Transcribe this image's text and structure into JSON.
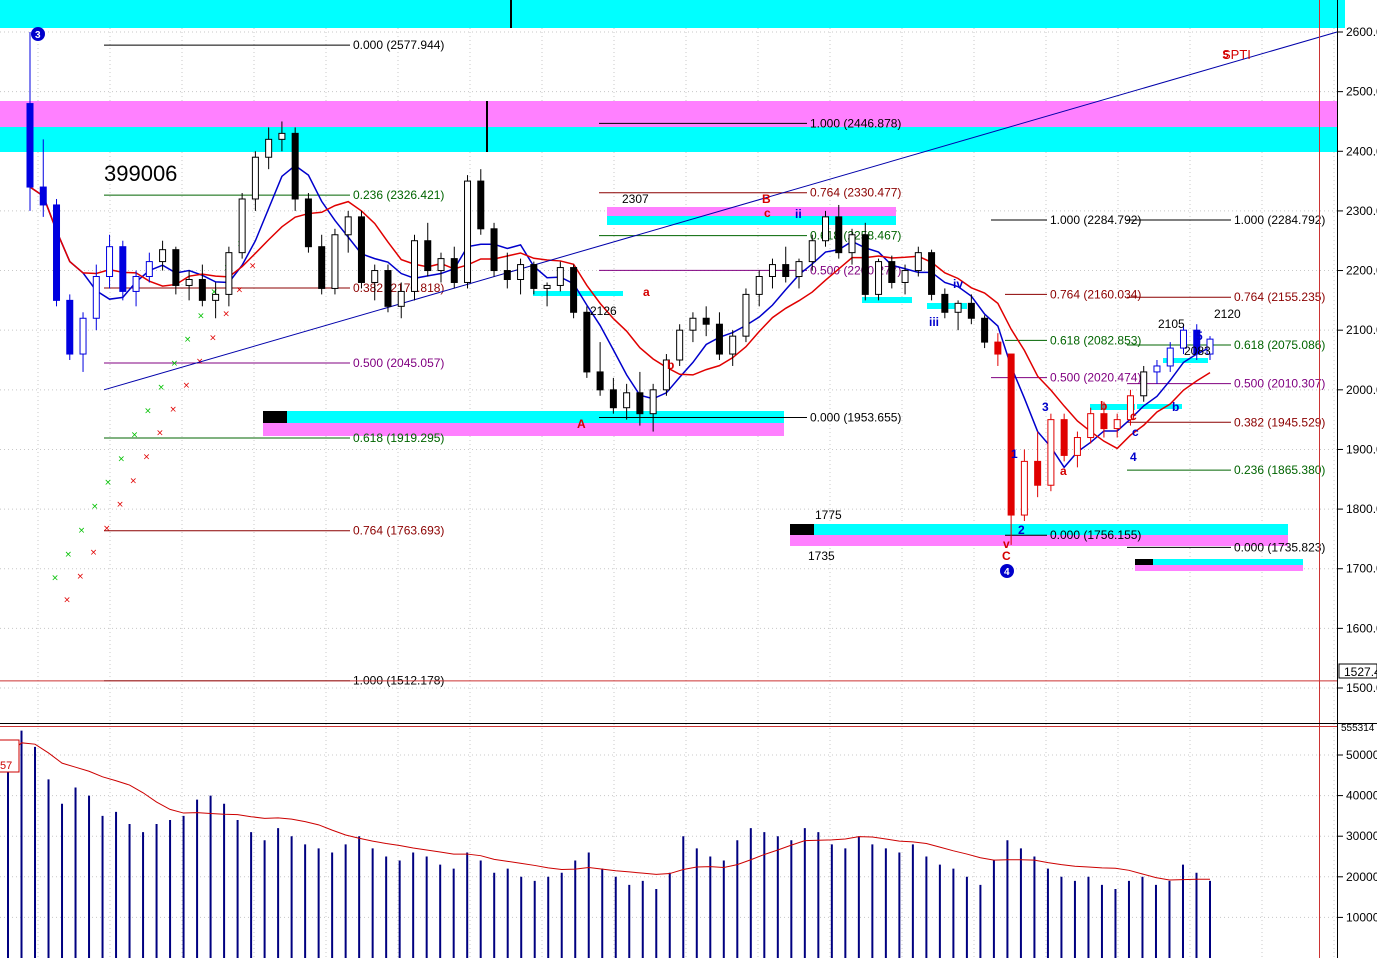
{
  "chart_data": {
    "type": "candlestick",
    "symbol": "399006",
    "indicator_tag": "SPTI",
    "price_axis": {
      "ticks": [
        "2600.0",
        "2500.0",
        "2400.0",
        "2300.0",
        "2200.0",
        "2100.0",
        "2000.0",
        "1900.0",
        "1800.0",
        "1700.0",
        "1600.0",
        "1500.0"
      ],
      "tick_values": [
        2600,
        2500,
        2400,
        2300,
        2200,
        2100,
        2000,
        1900,
        1800,
        1700,
        1600,
        1500
      ],
      "current_marker": "1527.4",
      "ylim": [
        1450,
        2660
      ]
    },
    "volume_axis": {
      "ticks": [
        "50000",
        "40000",
        "30000",
        "20000",
        "10000"
      ],
      "tick_values": [
        50000,
        40000,
        30000,
        20000,
        10000
      ],
      "top_marker": "555314",
      "left_marker": "57",
      "ylim": [
        0,
        56000
      ]
    },
    "fib_levels": [
      {
        "text": "0.000 (2577.944)",
        "value": 2577.944,
        "color": "#000000"
      },
      {
        "text": "0.236 (2326.421)",
        "value": 2326.421,
        "color": "#006400"
      },
      {
        "text": "0.382 (2170.818)",
        "value": 2170.818,
        "color": "#8b0000"
      },
      {
        "text": "0.500 (2045.057)",
        "value": 2045.057,
        "color": "#800080"
      },
      {
        "text": "0.618 (1919.295)",
        "value": 1919.295,
        "color": "#006400"
      },
      {
        "text": "0.764 (1763.693)",
        "value": 1763.693,
        "color": "#8b0000"
      },
      {
        "text": "1.000 (1512.178)",
        "value": 1512.178,
        "color": "#000000"
      },
      {
        "text": "1.000 (2446.878)",
        "value": 2446.878,
        "color": "#000000"
      },
      {
        "text": "0.764 (2330.477)",
        "value": 2330.477,
        "color": "#8b0000"
      },
      {
        "text": "0.618 (2258.467)",
        "value": 2258.467,
        "color": "#006400"
      },
      {
        "text": "0.500 (2200.277)",
        "value": 2200.277,
        "color": "#800080"
      },
      {
        "text": "0.000 (1953.655)",
        "value": 1953.655,
        "color": "#000000"
      },
      {
        "text": "1.000 (2284.792)",
        "value": 2284.792,
        "color": "#000000"
      },
      {
        "text": "0.764 (2160.034)",
        "value": 2160.034,
        "color": "#8b0000"
      },
      {
        "text": "0.618 (2082.853)",
        "value": 2082.853,
        "color": "#006400"
      },
      {
        "text": "0.500 (2020.474)",
        "value": 2020.474,
        "color": "#800080"
      },
      {
        "text": "0.000 (1756.155)",
        "value": 1756.155,
        "color": "#000000"
      },
      {
        "text": "1.000 (2284.792)",
        "value": 2284.792,
        "color": "#000000"
      },
      {
        "text": "0.764 (2155.235)",
        "value": 2155.235,
        "color": "#8b0000"
      },
      {
        "text": "0.618 (2075.086)",
        "value": 2075.086,
        "color": "#006400"
      },
      {
        "text": "0.500 (2010.307)",
        "value": 2010.307,
        "color": "#800080"
      },
      {
        "text": "0.382 (1945.529)",
        "value": 1945.529,
        "color": "#8b0000"
      },
      {
        "text": "0.236 (1865.380)",
        "value": 1865.38,
        "color": "#006400"
      },
      {
        "text": "0.000 (1735.823)",
        "value": 1735.823,
        "color": "#000000"
      }
    ],
    "price_labels": [
      "2307",
      "2126",
      "2105",
      "2120",
      "1775",
      "1735",
      "2083"
    ],
    "wave_labels": {
      "circled": [
        "3",
        "4",
        "5"
      ],
      "red": [
        "B",
        "c",
        "a",
        "b",
        "A",
        "C",
        "a",
        "b",
        "c",
        "v"
      ],
      "blue": [
        "ii",
        "iv",
        "iii",
        "1",
        "2",
        "3",
        "4",
        "5",
        "b",
        "c"
      ]
    },
    "series": [
      {
        "name": "candles",
        "type": "candlestick"
      },
      {
        "name": "ma-blue",
        "type": "line",
        "color": "#0000cc"
      },
      {
        "name": "ma-red",
        "type": "line",
        "color": "#e00000"
      },
      {
        "name": "sar-green",
        "type": "scatter",
        "color": "#00c000"
      },
      {
        "name": "sar-red",
        "type": "scatter",
        "color": "#e00000"
      },
      {
        "name": "volume",
        "type": "bar",
        "color": "#000080"
      },
      {
        "name": "volume-ma",
        "type": "line",
        "color": "#cc0000"
      }
    ],
    "candles": [
      [
        2480,
        2600,
        2300,
        2340
      ],
      [
        2340,
        2420,
        2290,
        2310
      ],
      [
        2310,
        2320,
        2140,
        2150
      ],
      [
        2150,
        2160,
        2050,
        2060
      ],
      [
        2060,
        2130,
        2030,
        2120
      ],
      [
        2120,
        2210,
        2100,
        2190
      ],
      [
        2190,
        2260,
        2170,
        2240
      ],
      [
        2240,
        2250,
        2150,
        2165
      ],
      [
        2165,
        2200,
        2140,
        2190
      ],
      [
        2190,
        2230,
        2180,
        2215
      ],
      [
        2215,
        2250,
        2200,
        2235
      ],
      [
        2235,
        2240,
        2160,
        2175
      ],
      [
        2175,
        2200,
        2150,
        2185
      ],
      [
        2185,
        2210,
        2140,
        2150
      ],
      [
        2150,
        2180,
        2120,
        2160
      ],
      [
        2160,
        2240,
        2140,
        2230
      ],
      [
        2230,
        2330,
        2220,
        2320
      ],
      [
        2320,
        2400,
        2300,
        2390
      ],
      [
        2390,
        2440,
        2370,
        2420
      ],
      [
        2420,
        2450,
        2400,
        2430
      ],
      [
        2430,
        2440,
        2300,
        2320
      ],
      [
        2320,
        2330,
        2230,
        2240
      ],
      [
        2240,
        2260,
        2160,
        2170
      ],
      [
        2170,
        2270,
        2160,
        2260
      ],
      [
        2260,
        2300,
        2230,
        2290
      ],
      [
        2290,
        2300,
        2170,
        2180
      ],
      [
        2180,
        2210,
        2150,
        2200
      ],
      [
        2200,
        2210,
        2130,
        2140
      ],
      [
        2140,
        2180,
        2120,
        2165
      ],
      [
        2165,
        2260,
        2150,
        2250
      ],
      [
        2250,
        2280,
        2190,
        2200
      ],
      [
        2200,
        2230,
        2180,
        2220
      ],
      [
        2220,
        2240,
        2170,
        2180
      ],
      [
        2180,
        2360,
        2170,
        2350
      ],
      [
        2350,
        2370,
        2260,
        2270
      ],
      [
        2270,
        2280,
        2190,
        2200
      ],
      [
        2200,
        2230,
        2170,
        2185
      ],
      [
        2185,
        2220,
        2160,
        2210
      ],
      [
        2210,
        2215,
        2160,
        2170
      ],
      [
        2170,
        2180,
        2140,
        2175
      ],
      [
        2175,
        2215,
        2165,
        2205
      ],
      [
        2205,
        2210,
        2120,
        2130
      ],
      [
        2130,
        2140,
        2020,
        2030
      ],
      [
        2030,
        2080,
        1990,
        2000
      ],
      [
        2000,
        2020,
        1960,
        1970
      ],
      [
        1970,
        2010,
        1950,
        1995
      ],
      [
        1995,
        2030,
        1940,
        1960
      ],
      [
        1960,
        2010,
        1930,
        2000
      ],
      [
        2000,
        2060,
        1990,
        2050
      ],
      [
        2050,
        2110,
        2040,
        2100
      ],
      [
        2100,
        2130,
        2080,
        2120
      ],
      [
        2120,
        2140,
        2090,
        2110
      ],
      [
        2110,
        2130,
        2050,
        2060
      ],
      [
        2060,
        2100,
        2040,
        2090
      ],
      [
        2090,
        2170,
        2080,
        2160
      ],
      [
        2160,
        2200,
        2140,
        2190
      ],
      [
        2190,
        2220,
        2170,
        2210
      ],
      [
        2210,
        2240,
        2180,
        2190
      ],
      [
        2190,
        2220,
        2170,
        2215
      ],
      [
        2215,
        2260,
        2200,
        2250
      ],
      [
        2250,
        2300,
        2240,
        2290
      ],
      [
        2290,
        2310,
        2220,
        2230
      ],
      [
        2230,
        2270,
        2210,
        2260
      ],
      [
        2260,
        2280,
        2150,
        2160
      ],
      [
        2160,
        2220,
        2150,
        2215
      ],
      [
        2215,
        2225,
        2170,
        2180
      ],
      [
        2180,
        2210,
        2160,
        2200
      ],
      [
        2200,
        2240,
        2190,
        2230
      ],
      [
        2230,
        2235,
        2150,
        2160
      ],
      [
        2160,
        2170,
        2120,
        2130
      ],
      [
        2130,
        2150,
        2100,
        2145
      ],
      [
        2145,
        2160,
        2110,
        2120
      ],
      [
        2120,
        2125,
        2070,
        2080
      ],
      [
        2080,
        2095,
        2040,
        2060
      ],
      [
        2060,
        1980,
        1740,
        1790
      ],
      [
        1790,
        1900,
        1780,
        1880
      ],
      [
        1880,
        1930,
        1820,
        1840
      ],
      [
        1840,
        1960,
        1830,
        1950
      ],
      [
        1950,
        1960,
        1880,
        1890
      ],
      [
        1890,
        1930,
        1870,
        1920
      ],
      [
        1920,
        1970,
        1910,
        1960
      ],
      [
        1960,
        1980,
        1920,
        1935
      ],
      [
        1935,
        1960,
        1920,
        1950
      ],
      [
        1950,
        2000,
        1940,
        1990
      ],
      [
        1990,
        2040,
        1980,
        2030
      ],
      [
        2030,
        2050,
        2010,
        2040
      ],
      [
        2040,
        2080,
        2030,
        2070
      ],
      [
        2070,
        2110,
        2060,
        2100
      ],
      [
        2100,
        2110,
        2050,
        2060
      ],
      [
        2060,
        2090,
        2050,
        2085
      ]
    ],
    "volume": [
      [
        0,
        50000
      ],
      [
        1,
        56000
      ],
      [
        2,
        52000
      ],
      [
        3,
        44000
      ],
      [
        4,
        38000
      ],
      [
        5,
        42000
      ],
      [
        6,
        40000
      ],
      [
        7,
        35000
      ],
      [
        8,
        36000
      ],
      [
        9,
        33000
      ],
      [
        10,
        31000
      ],
      [
        11,
        33000
      ],
      [
        12,
        34000
      ],
      [
        13,
        35000
      ],
      [
        14,
        39000
      ],
      [
        15,
        40000
      ],
      [
        16,
        38000
      ],
      [
        17,
        34000
      ],
      [
        18,
        31000
      ],
      [
        19,
        29000
      ],
      [
        20,
        32000
      ],
      [
        21,
        30000
      ],
      [
        22,
        28000
      ],
      [
        23,
        27000
      ],
      [
        24,
        26000
      ],
      [
        25,
        28000
      ],
      [
        26,
        30000
      ],
      [
        27,
        27000
      ],
      [
        28,
        25000
      ],
      [
        29,
        24000
      ],
      [
        30,
        26000
      ],
      [
        31,
        25000
      ],
      [
        32,
        23000
      ],
      [
        33,
        22000
      ],
      [
        34,
        26000
      ],
      [
        35,
        24000
      ],
      [
        36,
        21000
      ],
      [
        37,
        22000
      ],
      [
        38,
        20000
      ],
      [
        39,
        19000
      ],
      [
        40,
        20000
      ],
      [
        41,
        21000
      ],
      [
        42,
        24000
      ],
      [
        43,
        26000
      ],
      [
        44,
        22000
      ],
      [
        45,
        20000
      ],
      [
        46,
        18000
      ],
      [
        47,
        19000
      ],
      [
        48,
        17000
      ],
      [
        49,
        21000
      ],
      [
        50,
        30000
      ],
      [
        51,
        27000
      ],
      [
        52,
        25000
      ],
      [
        53,
        24000
      ],
      [
        54,
        29000
      ],
      [
        55,
        32000
      ],
      [
        56,
        31000
      ],
      [
        57,
        30000
      ],
      [
        58,
        29000
      ],
      [
        59,
        32000
      ],
      [
        60,
        31000
      ],
      [
        61,
        28000
      ],
      [
        62,
        27000
      ],
      [
        63,
        30000
      ],
      [
        64,
        28000
      ],
      [
        65,
        27000
      ],
      [
        66,
        26000
      ],
      [
        67,
        28000
      ],
      [
        68,
        25000
      ],
      [
        69,
        23000
      ],
      [
        70,
        22000
      ],
      [
        71,
        20000
      ],
      [
        72,
        18000
      ],
      [
        73,
        24000
      ],
      [
        74,
        29000
      ],
      [
        75,
        27000
      ],
      [
        76,
        25000
      ],
      [
        77,
        22000
      ],
      [
        78,
        20000
      ],
      [
        79,
        19000
      ],
      [
        80,
        20000
      ],
      [
        81,
        18000
      ],
      [
        82,
        17000
      ],
      [
        83,
        19000
      ],
      [
        84,
        20000
      ],
      [
        85,
        18000
      ],
      [
        86,
        19000
      ],
      [
        87,
        23000
      ],
      [
        88,
        21000
      ],
      [
        89,
        19000
      ]
    ]
  }
}
